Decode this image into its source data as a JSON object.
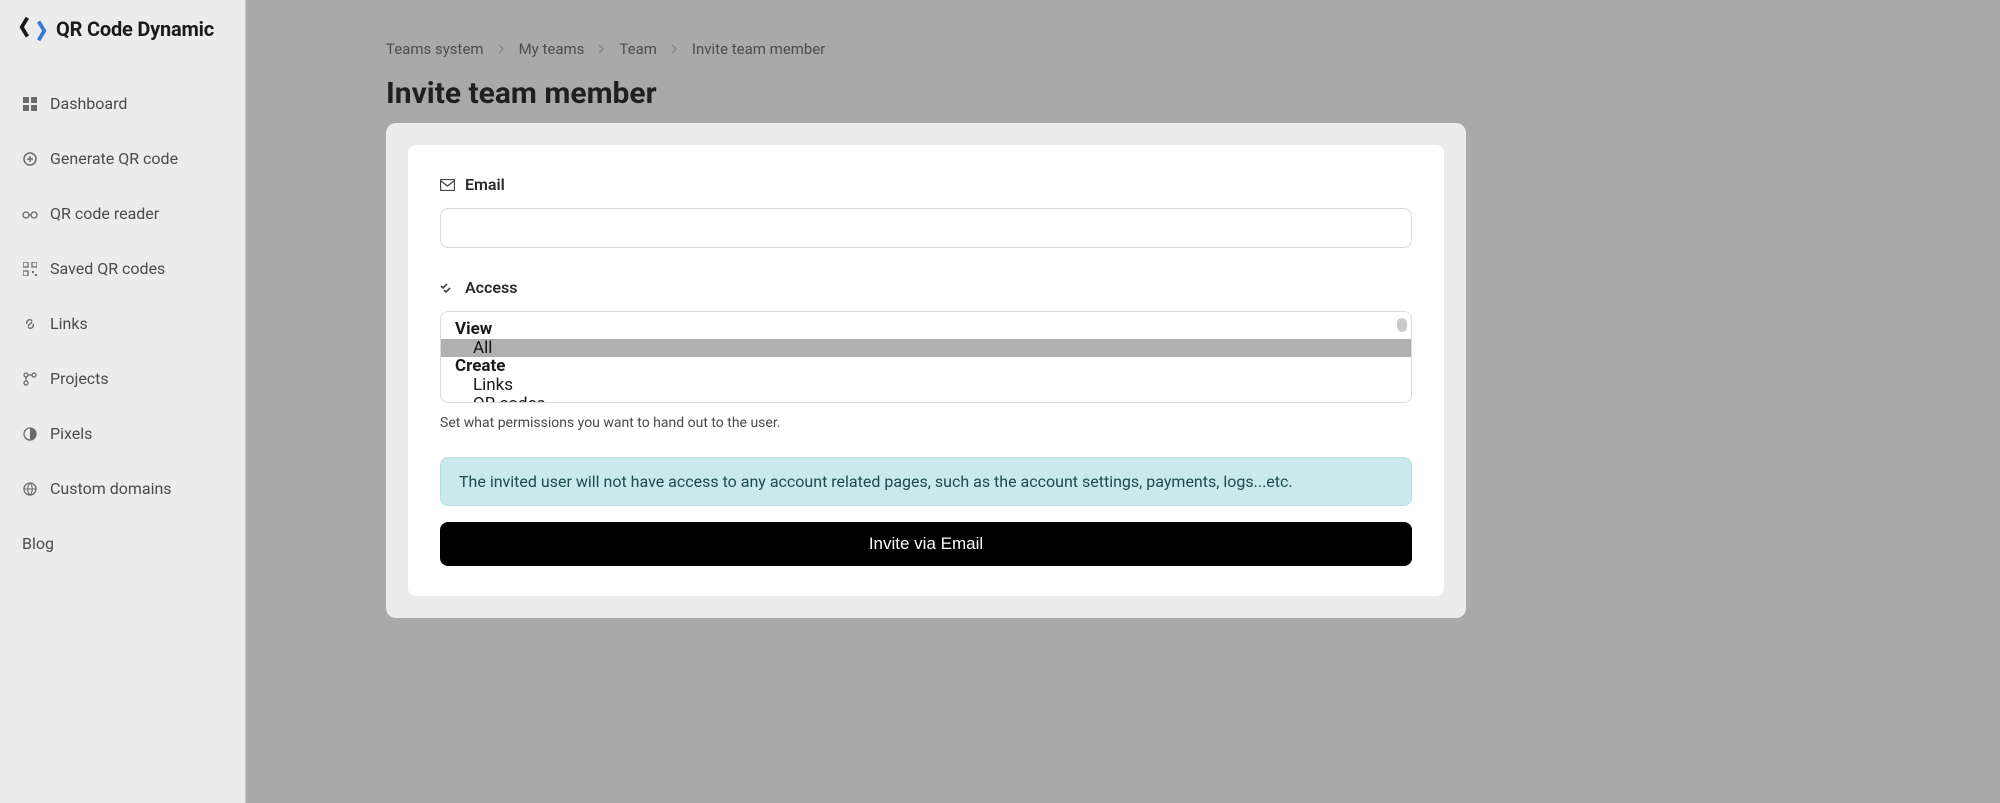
{
  "brand": {
    "name": "QR Code Dynamic"
  },
  "sidebar": {
    "items": [
      {
        "label": "Dashboard",
        "icon": "grid-icon"
      },
      {
        "label": "Generate QR code",
        "icon": "plus-circle-icon"
      },
      {
        "label": "QR code reader",
        "icon": "glasses-icon"
      },
      {
        "label": "Saved QR codes",
        "icon": "qr-icon"
      },
      {
        "label": "Links",
        "icon": "link-icon"
      },
      {
        "label": "Projects",
        "icon": "branch-icon"
      },
      {
        "label": "Pixels",
        "icon": "contrast-icon"
      },
      {
        "label": "Custom domains",
        "icon": "globe-icon"
      },
      {
        "label": "Blog",
        "icon": ""
      }
    ]
  },
  "breadcrumb": {
    "items": [
      "Teams system",
      "My teams",
      "Team",
      "Invite team member"
    ]
  },
  "page": {
    "title": "Invite team member"
  },
  "form": {
    "email_label": "Email",
    "access_label": "Access",
    "access_options": {
      "group1": "View",
      "group1_item1": "All",
      "group2": "Create",
      "group2_item1": "Links",
      "group2_item2": "QR codes"
    },
    "help_text": "Set what permissions you want to hand out to the user.",
    "info_banner": "The invited user will not have access to any account related pages, such as the account settings, payments, logs...etc.",
    "submit_label": "Invite via Email"
  }
}
